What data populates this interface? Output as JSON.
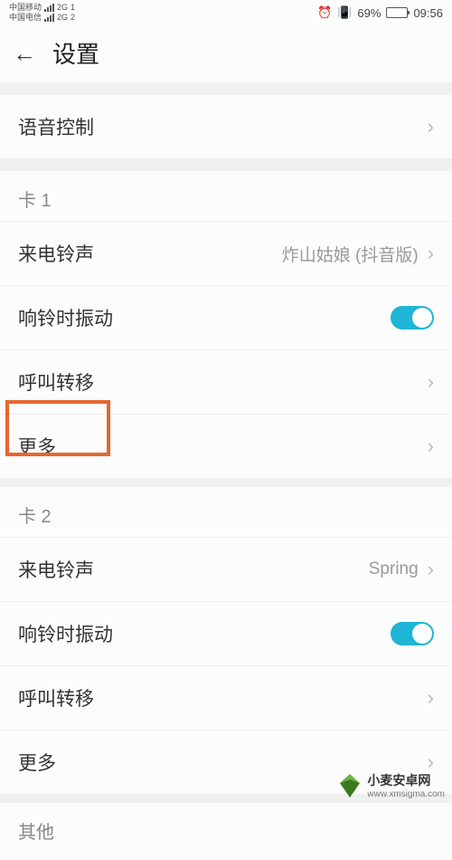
{
  "status": {
    "carrier1": "中国移动",
    "carrier2": "中国电信",
    "net": "2G",
    "sig1": "1",
    "sig2": "2",
    "battery_pct": "69%",
    "time": "09:56"
  },
  "header": {
    "title": "设置"
  },
  "groups": {
    "voice_control": "语音控制",
    "card1": {
      "label": "卡 1",
      "ringtone_label": "来电铃声",
      "ringtone_value": "炸山姑娘 (抖音版)",
      "vibrate_label": "响铃时振动",
      "call_forward_label": "呼叫转移",
      "more_label": "更多"
    },
    "card2": {
      "label": "卡 2",
      "ringtone_label": "来电铃声",
      "ringtone_value": "Spring",
      "vibrate_label": "响铃时振动",
      "call_forward_label": "呼叫转移",
      "more_label": "更多"
    },
    "other_label": "其他"
  },
  "watermark": {
    "text": "小麦安卓网",
    "url": "www.xmsigma.com"
  }
}
